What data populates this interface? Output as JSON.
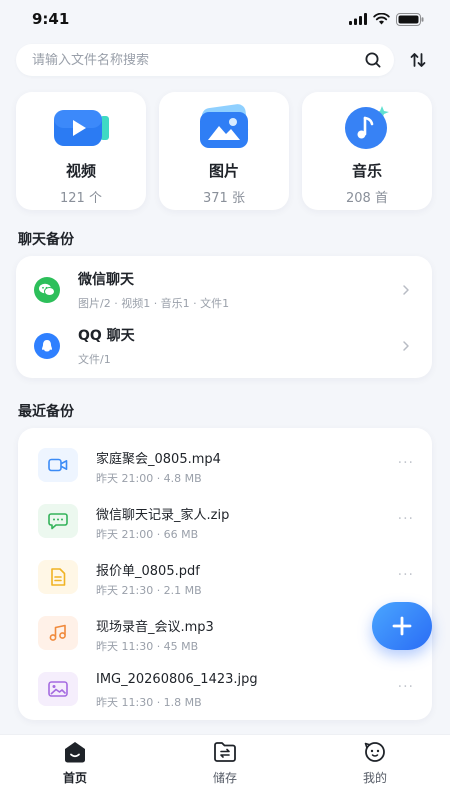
{
  "status_bar": {
    "time": "9:41"
  },
  "search": {
    "placeholder": "请输入文件名称搜索"
  },
  "categories": [
    {
      "name": "视频",
      "count": "121 个",
      "icon": "video-icon"
    },
    {
      "name": "图片",
      "count": "371 张",
      "icon": "image-icon"
    },
    {
      "name": "音乐",
      "count": "208 首",
      "icon": "music-icon"
    }
  ],
  "chat_section": {
    "title": "聊天备份",
    "items": [
      {
        "title": "微信聊天",
        "subtitle": "图片/2 · 视频1 · 音乐1 · 文件1",
        "icon": "wechat-icon"
      },
      {
        "title": "QQ 聊天",
        "subtitle": "文件/1",
        "icon": "qq-icon"
      }
    ]
  },
  "recent_section": {
    "title": "最近备份",
    "files": [
      {
        "name": "家庭聚会_0805.mp4",
        "meta": "昨天 21:00 · 4.8 MB",
        "icon": "video-file-icon"
      },
      {
        "name": "微信聊天记录_家人.zip",
        "meta": "昨天 21:00 · 66 MB",
        "icon": "chat-file-icon"
      },
      {
        "name": "报价单_0805.pdf",
        "meta": "昨天 21:30 · 2.1 MB",
        "icon": "document-file-icon"
      },
      {
        "name": "现场录音_会议.mp3",
        "meta": "昨天 11:30 · 45 MB",
        "icon": "audio-file-icon"
      },
      {
        "name": "IMG_20260806_1423.jpg",
        "meta": "昨天 11:30 · 1.8 MB",
        "icon": "image-file-icon"
      }
    ],
    "more_label": "···"
  },
  "fab": {
    "label": "+"
  },
  "tabs": [
    {
      "label": "首页",
      "icon": "home-icon",
      "active": true
    },
    {
      "label": "储存",
      "icon": "storage-folder-icon",
      "active": false
    },
    {
      "label": "我的",
      "icon": "profile-face-icon",
      "active": false
    }
  ],
  "colors": {
    "accent": "#2a6cf5",
    "wechat": "#2dbf5a",
    "qq": "#2f80ff",
    "background": "#f4f6fa"
  }
}
